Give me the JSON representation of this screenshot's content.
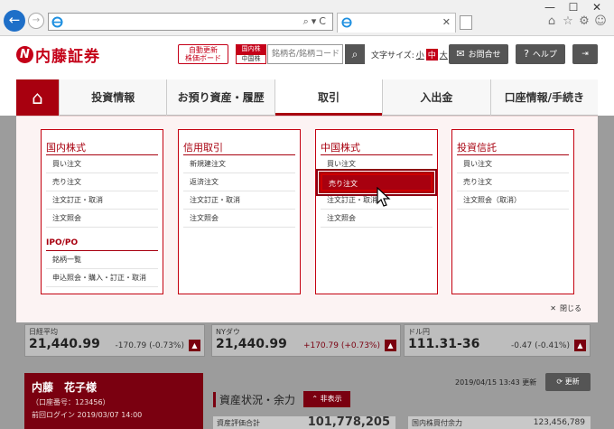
{
  "browser": {
    "tab_label": "",
    "window_controls": [
      "—",
      "☐",
      "✕"
    ],
    "address_tools": "⌕▾C"
  },
  "header": {
    "logo_text": "内藤証券",
    "auto_board_line1": "自動更新",
    "auto_board_line2": "株価ボード",
    "market_top": "国内株",
    "market_bottom": "中国株",
    "search_placeholder": "銘柄名/銘柄コード",
    "font_size_label": "文字サイズ:",
    "font_sizes": [
      "小",
      "中",
      "大"
    ],
    "contact_label": "お問合せ",
    "help_label": "ヘルプ"
  },
  "nav": {
    "items": [
      "投資情報",
      "お預り資産・履歴",
      "取引",
      "入出金",
      "口座情報/手続き"
    ],
    "active": "取引"
  },
  "dropdown": {
    "columns": [
      {
        "title": "国内株式",
        "items": [
          "買い注文",
          "売り注文",
          "注文訂正・取消",
          "注文照会"
        ],
        "subtitle": "IPO/PO",
        "sub_items": [
          "銘柄一覧",
          "申込照会・購入・訂正・取消"
        ]
      },
      {
        "title": "信用取引",
        "items": [
          "新規建注文",
          "返済注文",
          "注文訂正・取消",
          "注文照会"
        ]
      },
      {
        "title": "中国株式",
        "items": [
          "買い注文",
          "売り注文",
          "注文訂正・取消",
          "注文照会"
        ]
      },
      {
        "title": "投資信託",
        "items": [
          "買い注文",
          "売り注文",
          "注文照会（取消）"
        ]
      }
    ],
    "close_label": "閉じる"
  },
  "tickers": [
    {
      "label": "日経平均",
      "value": "21,440.99",
      "change": "-170.79 (-0.73%)",
      "dir": "neg"
    },
    {
      "label": "NYダウ",
      "value": "21,440.99",
      "change": "+170.79 (+0.73%)",
      "dir": "pos"
    },
    {
      "label": "ドル円",
      "value": "111.31-36",
      "change": "-0.47 (-0.41%)",
      "dir": "neg"
    }
  ],
  "user": {
    "name": "内藤　花子様",
    "account": "（口座番号：123456）",
    "last_login": "前回ログイン  2019/03/07 14:00"
  },
  "assets": {
    "updated": "2019/04/15 13:43 更新",
    "refresh_label": "更新",
    "title": "資産状況・余力",
    "hide_label": "非表示",
    "row1_label": "資産評価合計",
    "row1_value": "101,778,205",
    "row2_label": "国内株買付余力",
    "row2_value": "123,456,789"
  },
  "colors": {
    "brand": "#a8000f",
    "dark_gray": "#555555"
  }
}
